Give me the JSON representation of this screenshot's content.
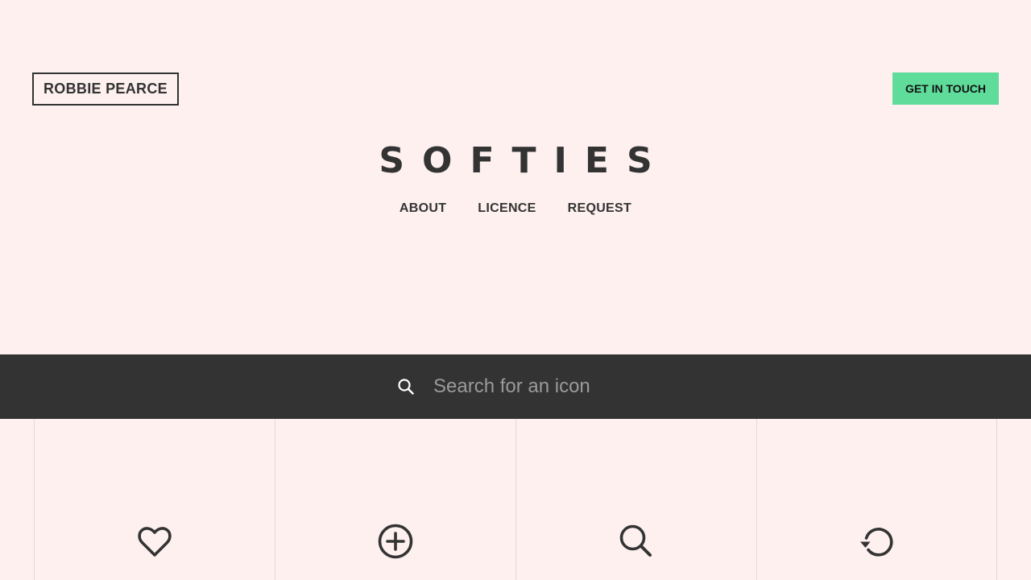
{
  "header": {
    "author_label": "ROBBIE PEARCE",
    "cta_label": "GET IN TOUCH",
    "cta_color": "#5fdc9a",
    "logo_text": "SOFTIES",
    "nav": [
      {
        "label": "ABOUT"
      },
      {
        "label": "LICENCE"
      },
      {
        "label": "REQUEST"
      }
    ]
  },
  "search": {
    "icon": "search-icon",
    "placeholder": "Search for an icon",
    "value": ""
  },
  "icon_grid": [
    {
      "icon": "heart-icon"
    },
    {
      "icon": "plus-circle-icon"
    },
    {
      "icon": "search-icon"
    },
    {
      "icon": "refresh-icon"
    }
  ],
  "colors": {
    "background": "#fdf0ef",
    "dark": "#333333",
    "accent": "#5fdc9a"
  }
}
